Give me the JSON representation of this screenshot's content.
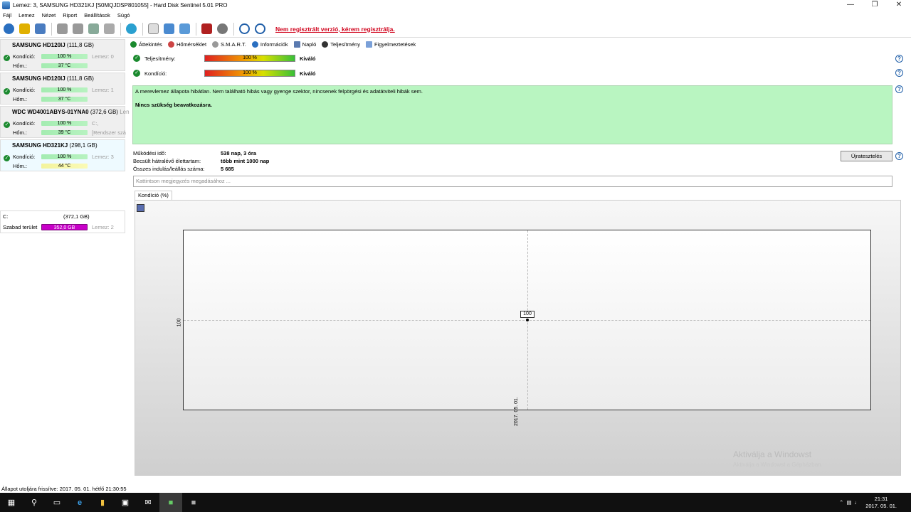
{
  "window": {
    "title": "Lemez: 3, SAMSUNG HD321KJ [S0MQJDSP801055]  -  Hard Disk Sentinel 5.01 PRO"
  },
  "menu": [
    "Fájl",
    "Lemez",
    "Nézet",
    "Riport",
    "Beállítások",
    "Súgó"
  ],
  "toolbar": {
    "reg_note": "Nem regisztrált verzió, kérem regisztrálja."
  },
  "disks": [
    {
      "name": "SAMSUNG HD120IJ",
      "cap": "(111,8 GB)",
      "kond_label": "Kondíció:",
      "kond": "100 %",
      "hom_label": "Hőm.:",
      "hom": "37 °C",
      "side": "Lemez: 0"
    },
    {
      "name": "SAMSUNG HD120IJ",
      "cap": "(111,8 GB)",
      "kond_label": "Kondíció:",
      "kond": "100 %",
      "hom_label": "Hőm.:",
      "hom": "37 °C",
      "side": "Lemez: 1"
    },
    {
      "name": "WDC WD4001ABYS-01YNA0",
      "cap": "(372,6 GB)",
      "kond_label": "Kondíció:",
      "kond": "100 %",
      "hom_label": "Hőm.:",
      "hom": "39 °C",
      "side": "C:,",
      "side2": "[Rendszer szá",
      "sideR": "Len"
    },
    {
      "name": "SAMSUNG HD321KJ",
      "cap": "(298,1 GB)",
      "kond_label": "Kondíció:",
      "kond": "100 %",
      "hom_label": "Hőm.:",
      "hom": "44 °C",
      "side": "Lemez: 3"
    }
  ],
  "volume": {
    "name": "C:",
    "cap": "(372,1 GB)",
    "free_label": "Szabad terület",
    "free": "352,0 GB",
    "side": "Lemez: 2"
  },
  "tabs": [
    "Áttekintés",
    "Hőmérséklet",
    "S.M.A.R.T.",
    "Információk",
    "Napló",
    "Teljesítmény",
    "Figyelmeztetések"
  ],
  "overview": {
    "perf_label": "Teljesítmény:",
    "perf_value": "100 %",
    "perf_qual": "Kiváló",
    "cond_label": "Kondíció:",
    "cond_value": "100 %",
    "cond_qual": "Kiváló",
    "status_text": "A merevlemez állapota hibátlan. Nem található hibás vagy gyenge szektor, nincsenek felpörgési és adatátviteli hibák sem.",
    "status_bold": "Nincs szükség beavatkozásra.",
    "uptime_label": "Működési idő:",
    "uptime": "538 nap, 3 óra",
    "life_label": "Becsült hátralévő élettartam:",
    "life": "több mint 1000 nap",
    "starts_label": "Összes indulás/leállás száma:",
    "starts": "5 685",
    "retest": "Újratesztelés",
    "note_placeholder": "Kattintson megjegyzés megadásához ..."
  },
  "chart_tab": "Kondíció  (%)",
  "chart_data": {
    "type": "line",
    "x": [
      "2017. 05. 01."
    ],
    "series": [
      {
        "values": [
          100
        ]
      }
    ],
    "ytick": "100",
    "xtick": "2017. 05. 01."
  },
  "watermark": {
    "line1": "Aktiválja a Windowst",
    "line2": "Aktiválja a Windowst a Gépházban."
  },
  "statusbar": "Állapot utoljára frissítve: 2017. 05. 01. hétfő 21:30:55",
  "clock": {
    "time": "21:31",
    "date": "2017. 05. 01."
  }
}
